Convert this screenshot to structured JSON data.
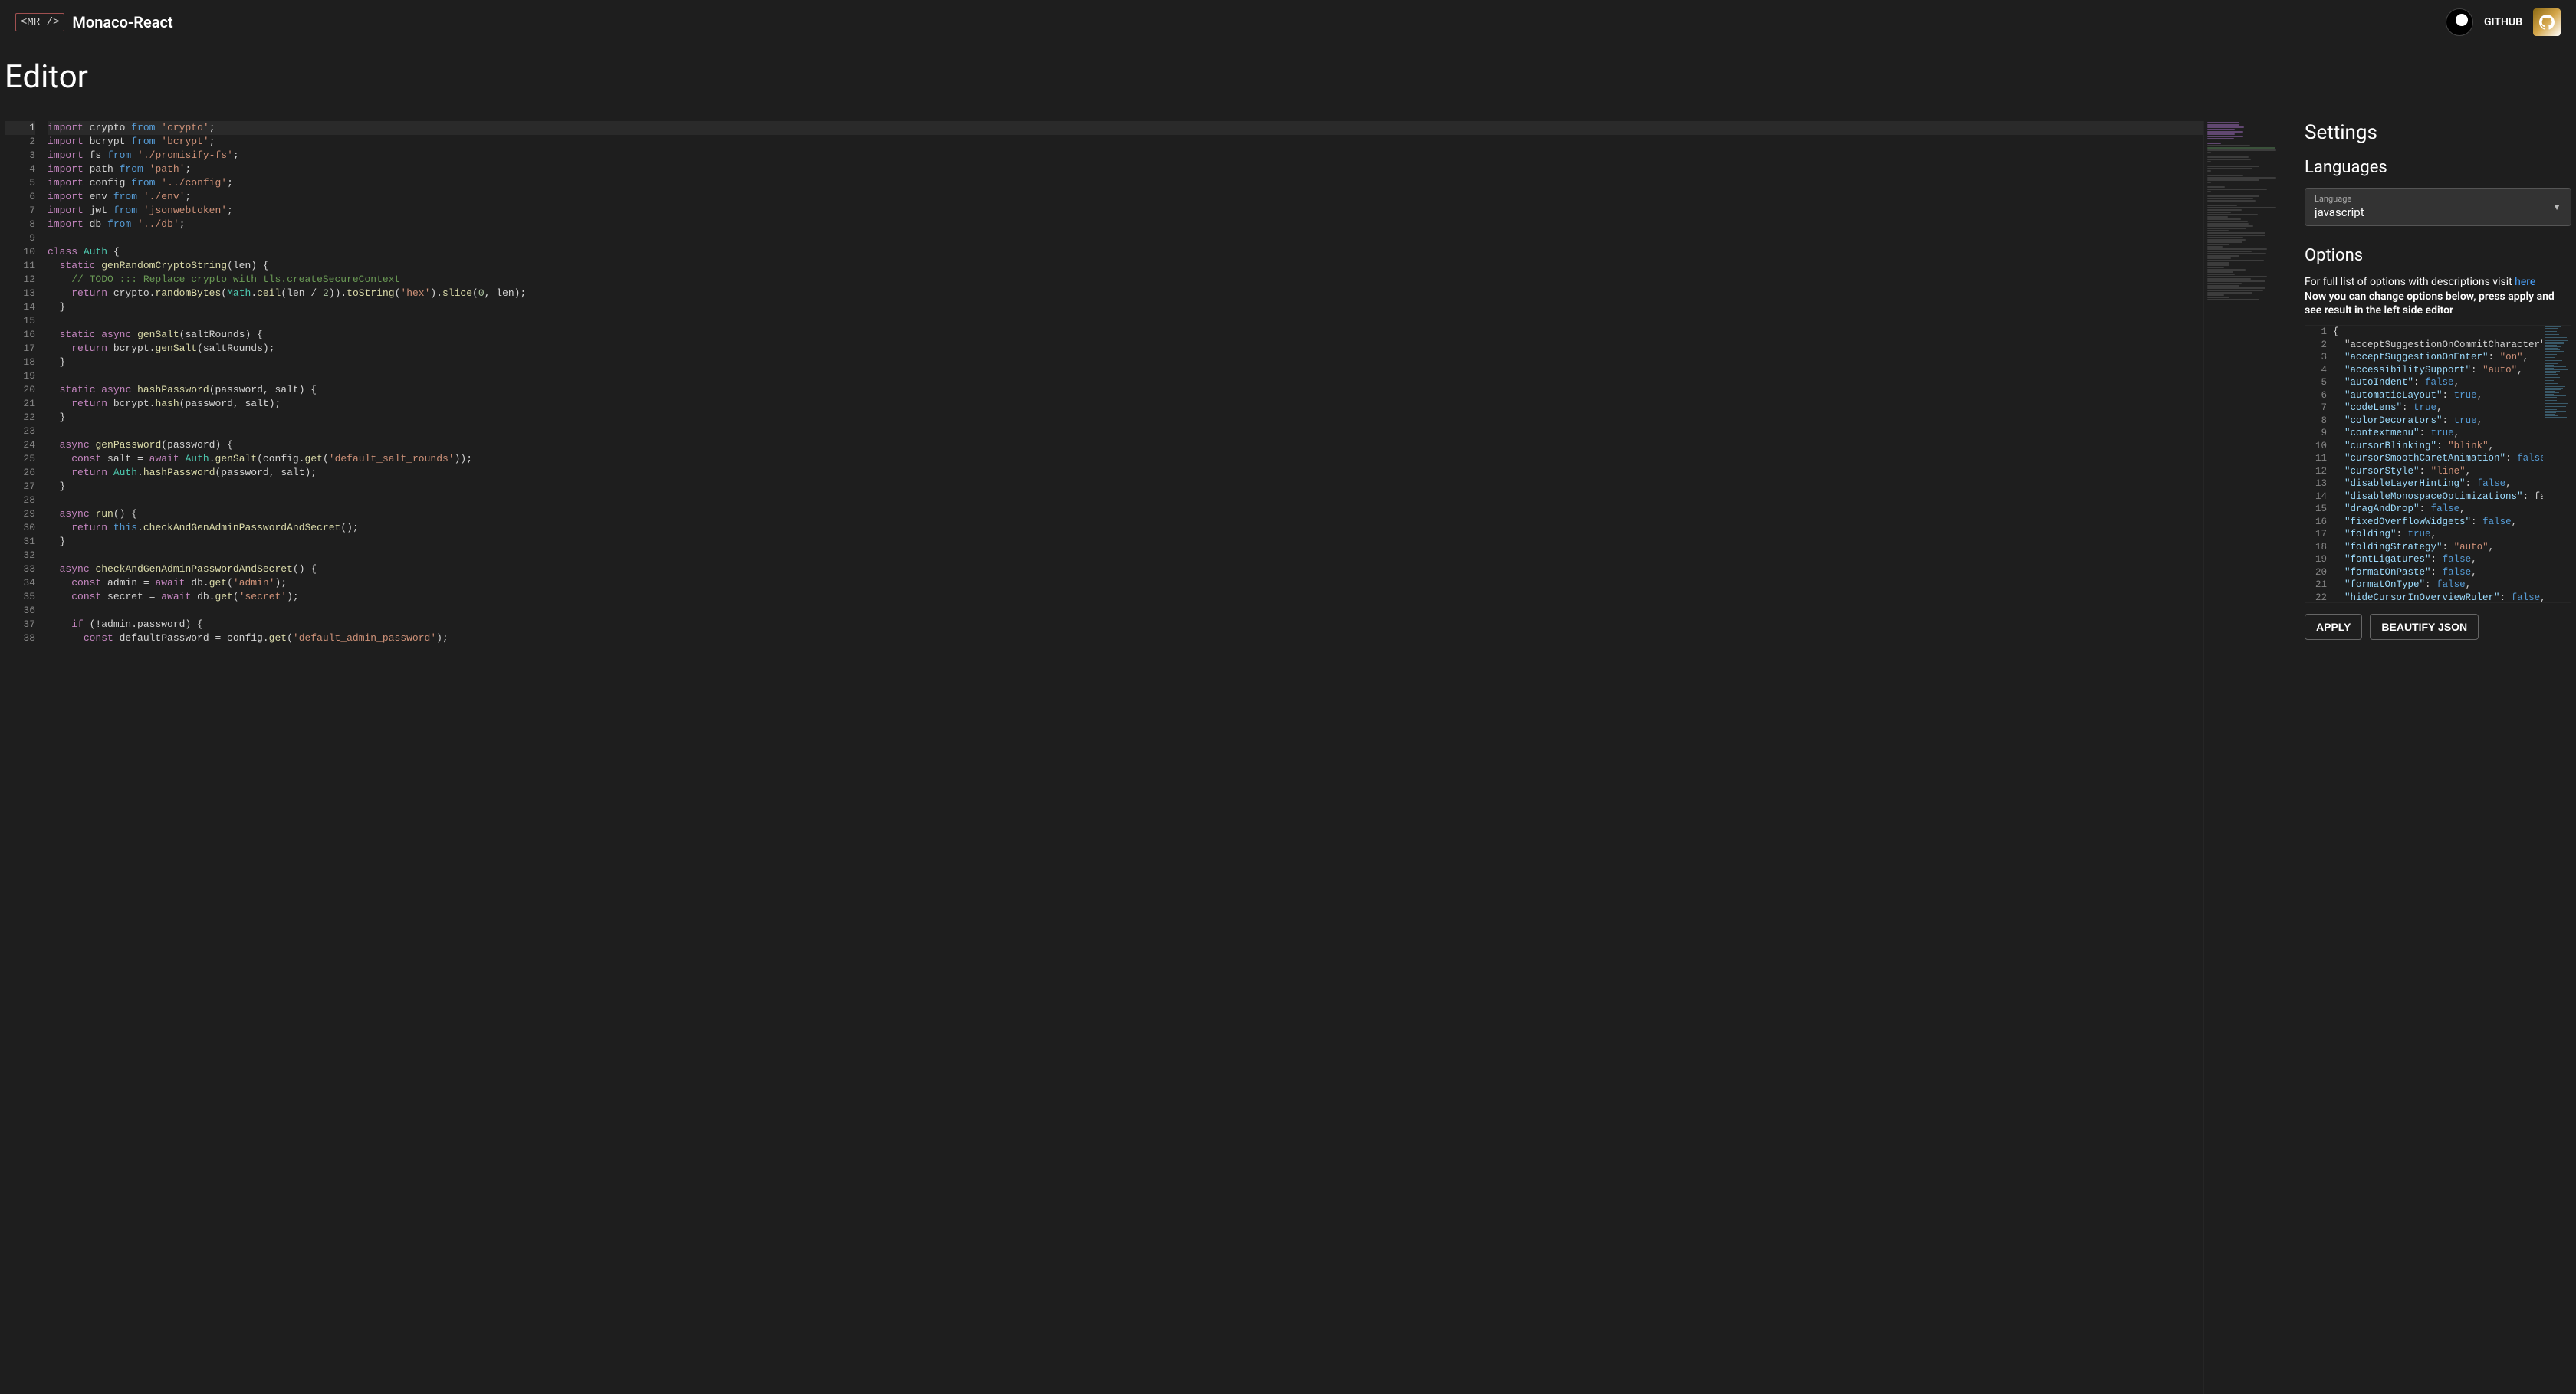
{
  "header": {
    "logo_badge": "<MR />",
    "app_title": "Monaco-React",
    "github_label": "GITHUB"
  },
  "page_title": "Editor",
  "editor": {
    "active_line": 1,
    "lines": [
      [
        [
          "kw",
          "import"
        ],
        [
          "",
          " crypto "
        ],
        [
          "mod",
          "from"
        ],
        [
          "",
          " "
        ],
        [
          "str",
          "'crypto'"
        ],
        [
          "",
          ";"
        ]
      ],
      [
        [
          "kw",
          "import"
        ],
        [
          "",
          " bcrypt "
        ],
        [
          "mod",
          "from"
        ],
        [
          "",
          " "
        ],
        [
          "str",
          "'bcrypt'"
        ],
        [
          "",
          ";"
        ]
      ],
      [
        [
          "kw",
          "import"
        ],
        [
          "",
          " fs "
        ],
        [
          "mod",
          "from"
        ],
        [
          "",
          " "
        ],
        [
          "str",
          "'./promisify-fs'"
        ],
        [
          "",
          ";"
        ]
      ],
      [
        [
          "kw",
          "import"
        ],
        [
          "",
          " path "
        ],
        [
          "mod",
          "from"
        ],
        [
          "",
          " "
        ],
        [
          "str",
          "'path'"
        ],
        [
          "",
          ";"
        ]
      ],
      [
        [
          "kw",
          "import"
        ],
        [
          "",
          " config "
        ],
        [
          "mod",
          "from"
        ],
        [
          "",
          " "
        ],
        [
          "str",
          "'../config'"
        ],
        [
          "",
          ";"
        ]
      ],
      [
        [
          "kw",
          "import"
        ],
        [
          "",
          " env "
        ],
        [
          "mod",
          "from"
        ],
        [
          "",
          " "
        ],
        [
          "str",
          "'./env'"
        ],
        [
          "",
          ";"
        ]
      ],
      [
        [
          "kw",
          "import"
        ],
        [
          "",
          " jwt "
        ],
        [
          "mod",
          "from"
        ],
        [
          "",
          " "
        ],
        [
          "str",
          "'jsonwebtoken'"
        ],
        [
          "",
          ";"
        ]
      ],
      [
        [
          "kw",
          "import"
        ],
        [
          "",
          " db "
        ],
        [
          "mod",
          "from"
        ],
        [
          "",
          " "
        ],
        [
          "str",
          "'../db'"
        ],
        [
          "",
          ";"
        ]
      ],
      [],
      [
        [
          "kw",
          "class"
        ],
        [
          "",
          " "
        ],
        [
          "type",
          "Auth"
        ],
        [
          "",
          " {"
        ]
      ],
      [
        [
          "",
          "  "
        ],
        [
          "kw",
          "static"
        ],
        [
          "",
          " "
        ],
        [
          "fn",
          "genRandomCryptoString"
        ],
        [
          "",
          "(len) {"
        ]
      ],
      [
        [
          "",
          "    "
        ],
        [
          "cmt",
          "// TODO ::: Replace crypto with tls.createSecureContext"
        ]
      ],
      [
        [
          "",
          "    "
        ],
        [
          "kw",
          "return"
        ],
        [
          "",
          " crypto."
        ],
        [
          "fn",
          "randomBytes"
        ],
        [
          "",
          "("
        ],
        [
          "type",
          "Math"
        ],
        [
          "",
          "."
        ],
        [
          "fn",
          "ceil"
        ],
        [
          "",
          "(len / "
        ],
        [
          "num",
          "2"
        ],
        [
          "",
          "))."
        ],
        [
          "fn",
          "toString"
        ],
        [
          "",
          "("
        ],
        [
          "str",
          "'hex'"
        ],
        [
          "",
          ")."
        ],
        [
          "fn",
          "slice"
        ],
        [
          "",
          "("
        ],
        [
          "num",
          "0"
        ],
        [
          "",
          ", len);"
        ]
      ],
      [
        [
          "",
          "  }"
        ]
      ],
      [],
      [
        [
          "",
          "  "
        ],
        [
          "kw",
          "static"
        ],
        [
          "",
          " "
        ],
        [
          "kw",
          "async"
        ],
        [
          "",
          " "
        ],
        [
          "fn",
          "genSalt"
        ],
        [
          "",
          "(saltRounds) {"
        ]
      ],
      [
        [
          "",
          "    "
        ],
        [
          "kw",
          "return"
        ],
        [
          "",
          " bcrypt."
        ],
        [
          "fn",
          "genSalt"
        ],
        [
          "",
          "(saltRounds);"
        ]
      ],
      [
        [
          "",
          "  }"
        ]
      ],
      [],
      [
        [
          "",
          "  "
        ],
        [
          "kw",
          "static"
        ],
        [
          "",
          " "
        ],
        [
          "kw",
          "async"
        ],
        [
          "",
          " "
        ],
        [
          "fn",
          "hashPassword"
        ],
        [
          "",
          "(password, salt) {"
        ]
      ],
      [
        [
          "",
          "    "
        ],
        [
          "kw",
          "return"
        ],
        [
          "",
          " bcrypt."
        ],
        [
          "fn",
          "hash"
        ],
        [
          "",
          "(password, salt);"
        ]
      ],
      [
        [
          "",
          "  }"
        ]
      ],
      [],
      [
        [
          "",
          "  "
        ],
        [
          "kw",
          "async"
        ],
        [
          "",
          " "
        ],
        [
          "fn",
          "genPassword"
        ],
        [
          "",
          "(password) {"
        ]
      ],
      [
        [
          "",
          "    "
        ],
        [
          "kw",
          "const"
        ],
        [
          "",
          " salt = "
        ],
        [
          "kw",
          "await"
        ],
        [
          "",
          " "
        ],
        [
          "type",
          "Auth"
        ],
        [
          "",
          "."
        ],
        [
          "fn",
          "genSalt"
        ],
        [
          "",
          "(config."
        ],
        [
          "fn",
          "get"
        ],
        [
          "",
          "("
        ],
        [
          "str",
          "'default_salt_rounds'"
        ],
        [
          "",
          "));"
        ]
      ],
      [
        [
          "",
          "    "
        ],
        [
          "kw",
          "return"
        ],
        [
          "",
          " "
        ],
        [
          "type",
          "Auth"
        ],
        [
          "",
          "."
        ],
        [
          "fn",
          "hashPassword"
        ],
        [
          "",
          "(password, salt);"
        ]
      ],
      [
        [
          "",
          "  }"
        ]
      ],
      [],
      [
        [
          "",
          "  "
        ],
        [
          "kw",
          "async"
        ],
        [
          "",
          " "
        ],
        [
          "fn",
          "run"
        ],
        [
          "",
          "() {"
        ]
      ],
      [
        [
          "",
          "    "
        ],
        [
          "kw",
          "return"
        ],
        [
          "",
          " "
        ],
        [
          "this",
          "this"
        ],
        [
          "",
          "."
        ],
        [
          "fn",
          "checkAndGenAdminPasswordAndSecret"
        ],
        [
          "",
          "();"
        ]
      ],
      [
        [
          "",
          "  }"
        ]
      ],
      [],
      [
        [
          "",
          "  "
        ],
        [
          "kw",
          "async"
        ],
        [
          "",
          " "
        ],
        [
          "fn",
          "checkAndGenAdminPasswordAndSecret"
        ],
        [
          "",
          "() {"
        ]
      ],
      [
        [
          "",
          "    "
        ],
        [
          "kw",
          "const"
        ],
        [
          "",
          " admin = "
        ],
        [
          "kw",
          "await"
        ],
        [
          "",
          " db."
        ],
        [
          "fn",
          "get"
        ],
        [
          "",
          "("
        ],
        [
          "str",
          "'admin'"
        ],
        [
          "",
          ");"
        ]
      ],
      [
        [
          "",
          "    "
        ],
        [
          "kw",
          "const"
        ],
        [
          "",
          " secret = "
        ],
        [
          "kw",
          "await"
        ],
        [
          "",
          " db."
        ],
        [
          "fn",
          "get"
        ],
        [
          "",
          "("
        ],
        [
          "str",
          "'secret'"
        ],
        [
          "",
          ");"
        ]
      ],
      [],
      [
        [
          "",
          "    "
        ],
        [
          "kw",
          "if"
        ],
        [
          "",
          " (!admin.password) {"
        ]
      ],
      [
        [
          "",
          "      "
        ],
        [
          "kw",
          "const"
        ],
        [
          "",
          " defaultPassword = config."
        ],
        [
          "fn",
          "get"
        ],
        [
          "",
          "("
        ],
        [
          "str",
          "'default_admin_password'"
        ],
        [
          "",
          ");"
        ]
      ]
    ]
  },
  "settings": {
    "heading": "Settings",
    "languages_heading": "Languages",
    "language_field_label": "Language",
    "language_value": "javascript",
    "options_heading": "Options",
    "hint_prefix": "For full list of options with descriptions visit ",
    "hint_link_text": "here",
    "hint_bold": "Now you can change options below, press apply and see result in the left side editor",
    "json_lines": [
      "{",
      "  \"acceptSuggestionOnCommitCharacter\"",
      "  \"acceptSuggestionOnEnter\": \"on\",",
      "  \"accessibilitySupport\": \"auto\",",
      "  \"autoIndent\": false,",
      "  \"automaticLayout\": true,",
      "  \"codeLens\": true,",
      "  \"colorDecorators\": true,",
      "  \"contextmenu\": true,",
      "  \"cursorBlinking\": \"blink\",",
      "  \"cursorSmoothCaretAnimation\": false",
      "  \"cursorStyle\": \"line\",",
      "  \"disableLayerHinting\": false,",
      "  \"disableMonospaceOptimizations\": fa",
      "  \"dragAndDrop\": false,",
      "  \"fixedOverflowWidgets\": false,",
      "  \"folding\": true,",
      "  \"foldingStrategy\": \"auto\",",
      "  \"fontLigatures\": false,",
      "  \"formatOnPaste\": false,",
      "  \"formatOnType\": false,",
      "  \"hideCursorInOverviewRuler\": false,"
    ],
    "apply_label": "APPLY",
    "beautify_label": "BEAUTIFY JSON"
  }
}
